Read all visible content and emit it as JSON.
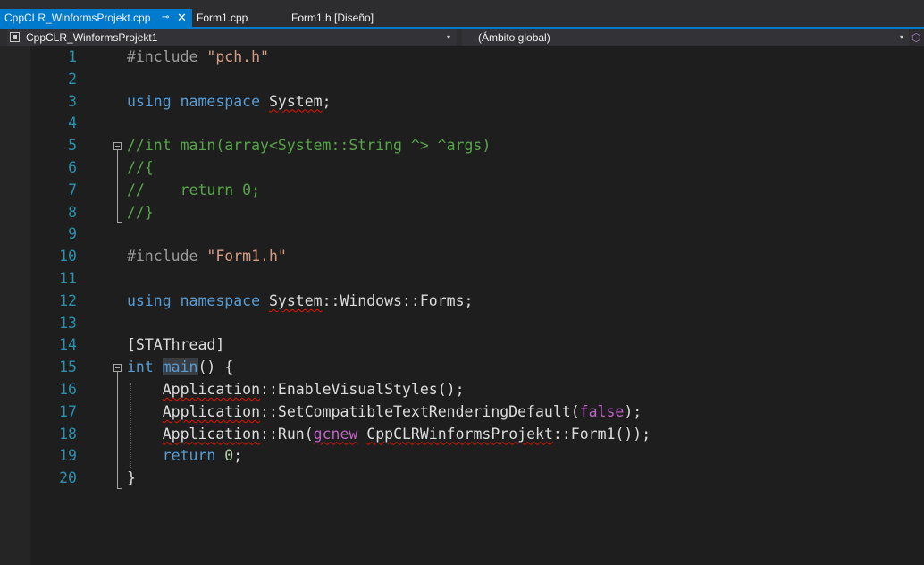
{
  "tabs": [
    {
      "label": "CppCLR_WinformsProjekt.cpp",
      "active": true,
      "pin_glyph": "⊸",
      "close_glyph": "✕"
    },
    {
      "label": "Form1.cpp",
      "active": false
    },
    {
      "label": "Form1.h [Diseño]",
      "active": false
    }
  ],
  "navbar": {
    "project_combo": "CppCLR_WinformsProjekt1",
    "scope_combo": "(Ámbito global)",
    "dropdown_glyph": "▾",
    "gear_glyph": "⬡"
  },
  "line_numbers": [
    "1",
    "2",
    "3",
    "4",
    "5",
    "6",
    "7",
    "8",
    "9",
    "10",
    "11",
    "12",
    "13",
    "14",
    "15",
    "16",
    "17",
    "18",
    "19",
    "20"
  ],
  "code": {
    "l1": {
      "directive": "#include",
      "file": "\"pch.h\""
    },
    "l3": {
      "kw1": "using",
      "kw2": "namespace",
      "ns": "System",
      "end": ";"
    },
    "l5": {
      "text": "//int main(array<System::String ^> ^args)"
    },
    "l6": {
      "text": "//{"
    },
    "l7": {
      "text": "//    return 0;"
    },
    "l8": {
      "text": "//}"
    },
    "l10": {
      "directive": "#include",
      "file": "\"Form1.h\""
    },
    "l12": {
      "kw1": "using",
      "kw2": "namespace",
      "ns": "System",
      "sep1": "::",
      "ns2": "Windows",
      "sep2": "::",
      "ns3": "Forms",
      "end": ";"
    },
    "l14": {
      "text": "[STAThread]"
    },
    "l15": {
      "type": "int",
      "name": "main",
      "rest": "() {"
    },
    "l16": {
      "cls": "Application",
      "sep": "::",
      "rest": "EnableVisualStyles();"
    },
    "l17": {
      "cls": "Application",
      "sep": "::",
      "call": "SetCompatibleTextRenderingDefault(",
      "arg": "false",
      "end": ");"
    },
    "l18": {
      "cls": "Application",
      "sep": "::",
      "call": "Run(",
      "gc": "gcnew",
      "space": " ",
      "cls2": "CppCLRWinformsProjekt",
      "sep2": "::",
      "rest": "Form1());"
    },
    "l19": {
      "kw": "return",
      "num": "0",
      "end": ";"
    },
    "l20": {
      "text": "}"
    }
  }
}
